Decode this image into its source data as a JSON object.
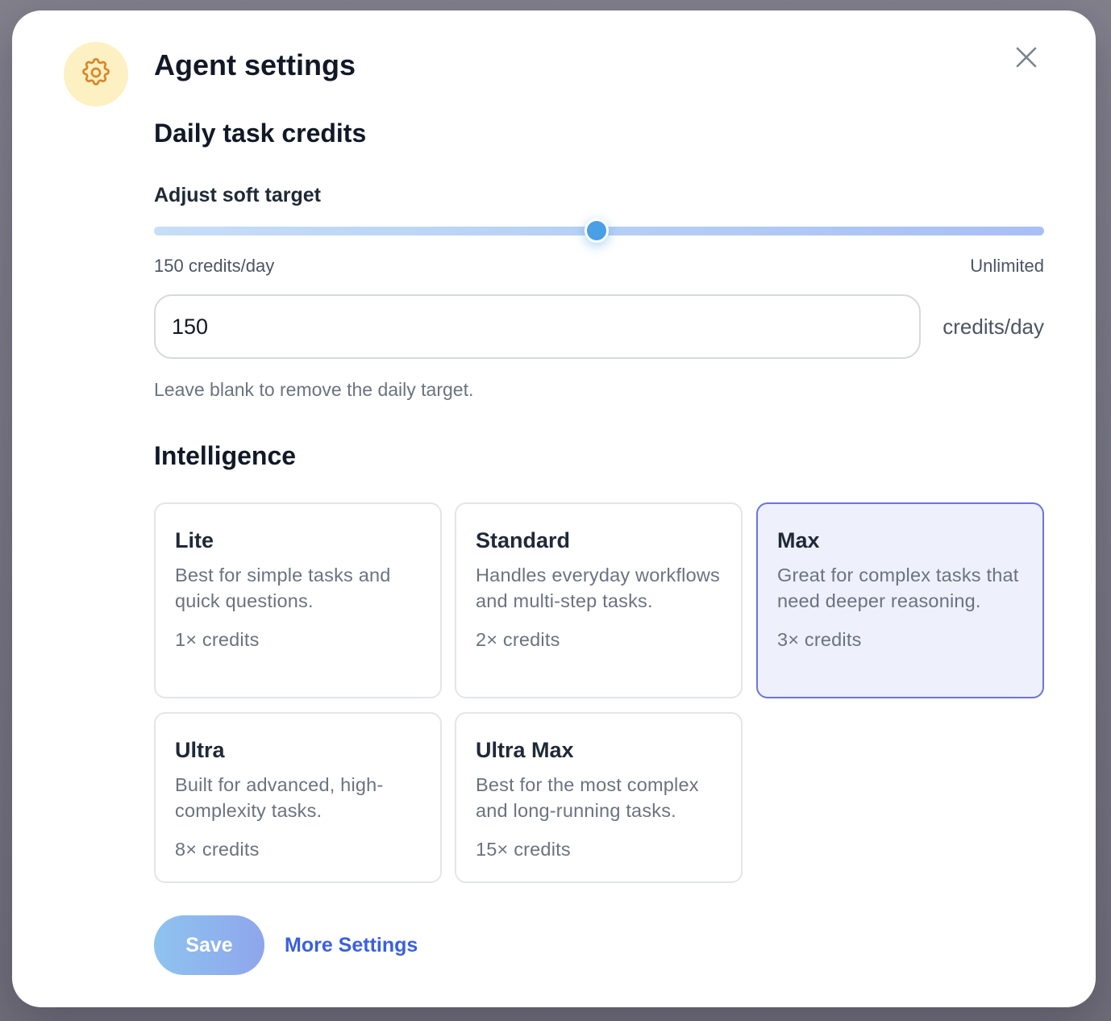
{
  "modal": {
    "title": "Agent settings",
    "icon": "gear-icon",
    "accent_color": "#d7862a"
  },
  "daily_credits": {
    "heading": "Daily task credits",
    "slider_label": "Adjust soft target",
    "slider_value_fraction": 0.497,
    "range_min_label": "150 credits/day",
    "range_max_label": "Unlimited",
    "input_value": "150",
    "unit": "credits/day",
    "hint": "Leave blank to remove the daily target."
  },
  "intelligence": {
    "heading": "Intelligence",
    "selected": "Max",
    "tiers": [
      {
        "name": "Lite",
        "description": "Best for simple tasks and quick questions.",
        "credits": "1× credits"
      },
      {
        "name": "Standard",
        "description": "Handles everyday workflows and multi-step tasks.",
        "credits": "2× credits"
      },
      {
        "name": "Max",
        "description": "Great for complex tasks that need deeper reasoning.",
        "credits": "3× credits"
      },
      {
        "name": "Ultra",
        "description": "Built for advanced, high-complexity tasks.",
        "credits": "8× credits"
      },
      {
        "name": "Ultra Max",
        "description": "Best for the most complex and long-running tasks.",
        "credits": "15× credits"
      }
    ]
  },
  "actions": {
    "save_label": "Save",
    "more_settings_label": "More Settings"
  }
}
